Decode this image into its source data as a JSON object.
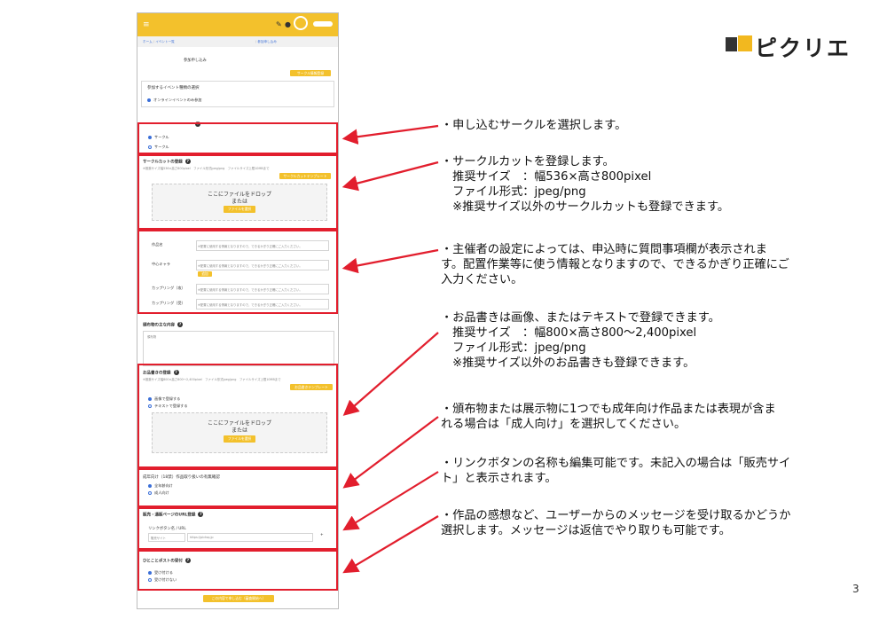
{
  "logo": {
    "text": "ピクリエ",
    "colors": [
      "#f2b81f",
      "#333333"
    ]
  },
  "page_number": "3",
  "screenshot": {
    "header": {
      "accent": "#f3c12c"
    },
    "breadcrumb": [
      "ホーム",
      "イベント一覧",
      "参加申し込み"
    ],
    "page_title": "参加申し込み",
    "circle_info_button": "サークル情報登録",
    "event_type": {
      "label": "参加するイベント種類の選択",
      "option": "オンラインイベントのみ参加"
    },
    "circle_select": {
      "options": [
        "サークル",
        "サークル"
      ]
    },
    "circle_cut": {
      "label": "サークルカットの登録",
      "hint": "※推奨サイズ幅536×高さ800pixel　ファイル形式jpeg/png　ファイルサイズ上限10MBまで",
      "template_button": "サークルカットテンプレート",
      "drop_text": "ここにファイルをドロップ",
      "or_text": "または",
      "select_button": "ファイルを選択"
    },
    "questions": {
      "rows": [
        {
          "label": "作品名",
          "hint": "※配置に使用する情報となりますので、できるかぎり正確にご入力ください。"
        },
        {
          "label": "中心キャラ",
          "hint": "※配置に使用する情報となりますので、できるかぎり正確にご入力ください。",
          "button": "追加"
        },
        {
          "label": "カップリング（攻）",
          "hint": "※配置に使用する情報となりますので、できるかぎり正確にご入力ください。"
        },
        {
          "label": "カップリング（受）",
          "hint": "※配置に使用する情報となりますので、できるかぎり正確にご入力ください。"
        }
      ]
    },
    "activity": {
      "label": "頒布物の主な内容",
      "placeholder": "頒布物"
    },
    "menu": {
      "label": "お品書きの登録",
      "hint": "※推奨サイズ幅800×高さ800〜2,400pixel　ファイル形式jpeg/png　ファイルサイズ上限10MBまで",
      "template_button": "お品書きテンプレート",
      "options": [
        "画像で登録する",
        "テキストで登録する"
      ],
      "drop_text": "ここにファイルをドロップ",
      "or_text": "または",
      "select_button": "ファイルを選択"
    },
    "adult": {
      "label": "成年向け（18禁）作品取り扱いの有無確認",
      "options": [
        "全年齢向け",
        "成人向け"
      ]
    },
    "sales": {
      "label": "販売・通販ページのURL登録",
      "sublabel": "リンクボタン名 / URL",
      "name_placeholder": "販売サイト",
      "url_placeholder": "https://pictsq.jp",
      "add": "+"
    },
    "hitokoto": {
      "label": "ひとことポストの受付",
      "options": [
        "受け付ける",
        "受け付けない"
      ]
    },
    "submit": "この内容で申し込む（審査開始へ）"
  },
  "notes": [
    "・申し込むサークルを選択します。",
    "・サークルカットを登録します。\n　推奨サイズ　：幅536×高さ800pixel\n　ファイル形式：jpeg/png\n　※推奨サイズ以外のサークルカットも登録できます。",
    "・主催者の設定によっては、申込時に質問事項欄が表示されま\nす。配置作業等に使う情報となりますので、できるかぎり正確にご\n入力ください。",
    "・お品書きは画像、またはテキストで登録できます。\n　推奨サイズ　：幅800×高さ800～2,400pixel\n　ファイル形式：jpeg/png\n　※推奨サイズ以外のお品書きも登録できます。",
    "・頒布物または展示物に1つでも成年向け作品または表現が含ま\nれる場合は「成人向け」を選択してください。",
    "・リンクボタンの名称も編集可能です。未記入の場合は「販売サイ\nト」と表示されます。",
    "・作品の感想など、ユーザーからのメッセージを受け取るかどうか\n選択します。メッセージは返信でやり取りも可能です。"
  ],
  "annotation_color": "#e21e2d"
}
